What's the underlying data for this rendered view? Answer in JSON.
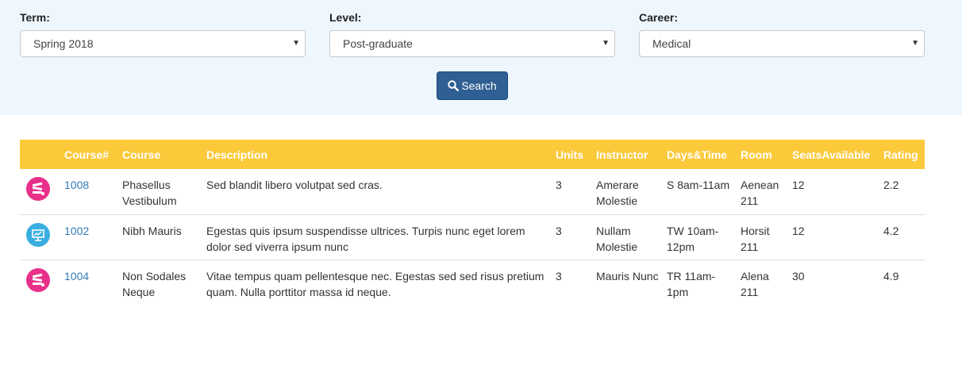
{
  "filters": {
    "term": {
      "label": "Term:",
      "value": "Spring 2018"
    },
    "level": {
      "label": "Level:",
      "value": "Post-graduate"
    },
    "career": {
      "label": "Career:",
      "value": "Medical"
    },
    "search_label": "Search"
  },
  "table": {
    "columns": [
      "",
      "Course#",
      "Course",
      "Description",
      "Units",
      "Instructor",
      "Days&Time",
      "Room",
      "SeatsAvailable",
      "Rating"
    ],
    "rows": [
      {
        "icon": "books-icon",
        "icon_color": "#e8308a",
        "number": "1008",
        "course": "Phasellus Vestibulum",
        "description": "Sed blandit libero volutpat sed cras.",
        "units": "3",
        "instructor": "Amerare Molestie",
        "days_time": "S 8am-11am",
        "room": "Aenean 211",
        "seats": "12",
        "rating": "2.2"
      },
      {
        "icon": "presentation-icon",
        "icon_color": "#3aaee0",
        "number": "1002",
        "course": "Nibh Mauris",
        "description": "Egestas quis ipsum suspendisse ultrices. Turpis nunc eget lorem dolor sed viverra ipsum nunc",
        "units": "3",
        "instructor": "Nullam Molestie",
        "days_time": "TW 10am-12pm",
        "room": "Horsit 211",
        "seats": "12",
        "rating": "4.2"
      },
      {
        "icon": "books-icon",
        "icon_color": "#e8308a",
        "number": "1004",
        "course": "Non Sodales Neque",
        "description": "Vitae tempus quam pellentesque nec. Egestas sed sed risus pretium quam. Nulla porttitor massa id neque.",
        "units": "3",
        "instructor": "Mauris Nunc",
        "days_time": "TR 11am-1pm",
        "room": "Alena 211",
        "seats": "30",
        "rating": "4.9"
      }
    ]
  },
  "colors": {
    "header": "#fcc93b",
    "panel": "#eef6fe",
    "button": "#2f5f93",
    "link": "#337ab7"
  }
}
